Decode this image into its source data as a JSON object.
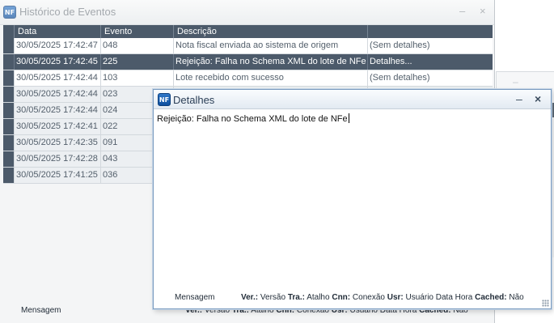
{
  "background_window": {
    "title": "Histórico de Eventos",
    "minimize_glyph": "–",
    "close_glyph": "×",
    "columns": [
      "Data",
      "Evento",
      "Descrição",
      ""
    ],
    "rows": [
      {
        "data": "30/05/2025 17:42:47",
        "evento": "048",
        "descricao": "Nota fiscal enviada ao sistema de origem",
        "detalhes": "(Sem detalhes)"
      },
      {
        "data": "30/05/2025 17:42:45",
        "evento": "225",
        "descricao": "Rejeição: Falha no Schema XML do lote de NFe",
        "detalhes": "Detalhes..."
      },
      {
        "data": "30/05/2025 17:42:44",
        "evento": "103",
        "descricao": "Lote recebido com sucesso",
        "detalhes": "(Sem detalhes)"
      },
      {
        "data": "30/05/2025 17:42:44",
        "evento": "023",
        "descricao": "",
        "detalhes": ""
      },
      {
        "data": "30/05/2025 17:42:44",
        "evento": "024",
        "descricao": "",
        "detalhes": ""
      },
      {
        "data": "30/05/2025 17:42:41",
        "evento": "022",
        "descricao": "",
        "detalhes": ""
      },
      {
        "data": "30/05/2025 17:42:35",
        "evento": "091",
        "descricao": "",
        "detalhes": ""
      },
      {
        "data": "30/05/2025 17:42:28",
        "evento": "043",
        "descricao": "",
        "detalhes": ""
      },
      {
        "data": "30/05/2025 17:41:25",
        "evento": "036",
        "descricao": "",
        "detalhes": ""
      }
    ],
    "selected_row": 1,
    "status": {
      "left": "Mensagem",
      "ver_label": "Ver.:",
      "ver_value": "Versão",
      "tra_label": "Tra.:",
      "tra_value": "Atalho",
      "cnn_label": "Cnn:",
      "cnn_value": "Conexão",
      "usr_label": "Usr:",
      "usr_value": "Usuário",
      "date_value": "Data",
      "time_value": "Hora",
      "cached_label": "Cached:",
      "cached_value": "Não"
    }
  },
  "dialog": {
    "title": "Detalhes",
    "minimize_glyph": "–",
    "close_glyph": "×",
    "text": "Rejeição: Falha no Schema XML do lote de NFe",
    "status": {
      "left": "Mensagem",
      "ver_label": "Ver.:",
      "ver_value": "Versão",
      "tra_label": "Tra.:",
      "tra_value": "Atalho",
      "cnn_label": "Cnn:",
      "cnn_value": "Conexão",
      "usr_label": "Usr:",
      "usr_value": "Usuário",
      "date_value": "Data",
      "time_value": "Hora",
      "cached_label": "Cached:",
      "cached_value": "Não"
    }
  },
  "logo_text": "NF",
  "colors": {
    "header_bg": "#4c5a6a",
    "selected_row_bg": "#4c5a6a",
    "dialog_border": "#7b9cc0"
  }
}
